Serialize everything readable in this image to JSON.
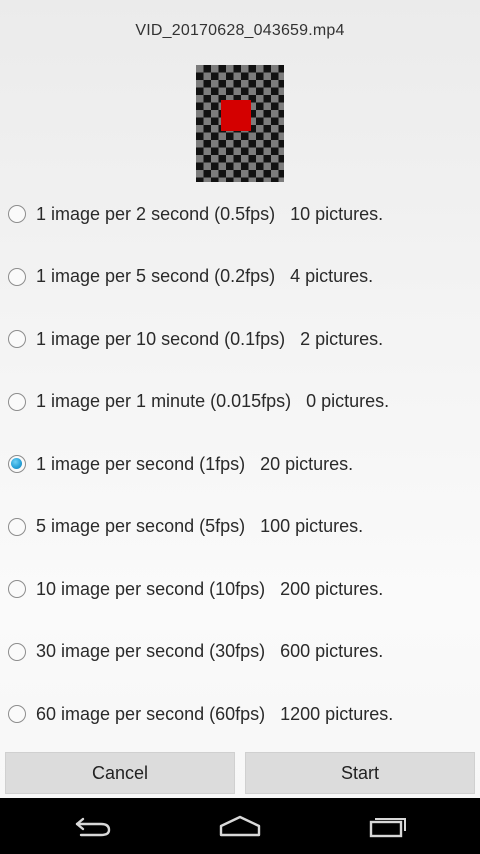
{
  "header": {
    "filename": "VID_20170628_043659.mp4"
  },
  "thumbnail": {
    "icon": "video-thumbnail-checkerboard",
    "accent_color": "#d40000"
  },
  "options": [
    {
      "label": "1 image per 2 second (0.5fps)   10 pictures.",
      "selected": false
    },
    {
      "label": "1 image per 5 second (0.2fps)   4 pictures.",
      "selected": false
    },
    {
      "label": "1 image per 10 second (0.1fps)   2 pictures.",
      "selected": false
    },
    {
      "label": "1 image per 1 minute (0.015fps)   0 pictures.",
      "selected": false
    },
    {
      "label": "1 image per second (1fps)   20 pictures.",
      "selected": true
    },
    {
      "label": "5 image per second (5fps)   100 pictures.",
      "selected": false
    },
    {
      "label": "10 image per second (10fps)   200 pictures.",
      "selected": false
    },
    {
      "label": "30 image per second (30fps)   600 pictures.",
      "selected": false
    },
    {
      "label": "60 image per second (60fps)   1200 pictures.",
      "selected": false
    }
  ],
  "buttons": {
    "cancel": "Cancel",
    "start": "Start"
  },
  "navbar": {
    "back_icon": "back-icon",
    "home_icon": "home-icon",
    "recent_icon": "recent-apps-icon"
  },
  "colors": {
    "radio_selected": "#2aa3d9",
    "button_bg": "#dcdcdc",
    "navbar_bg": "#000000"
  }
}
